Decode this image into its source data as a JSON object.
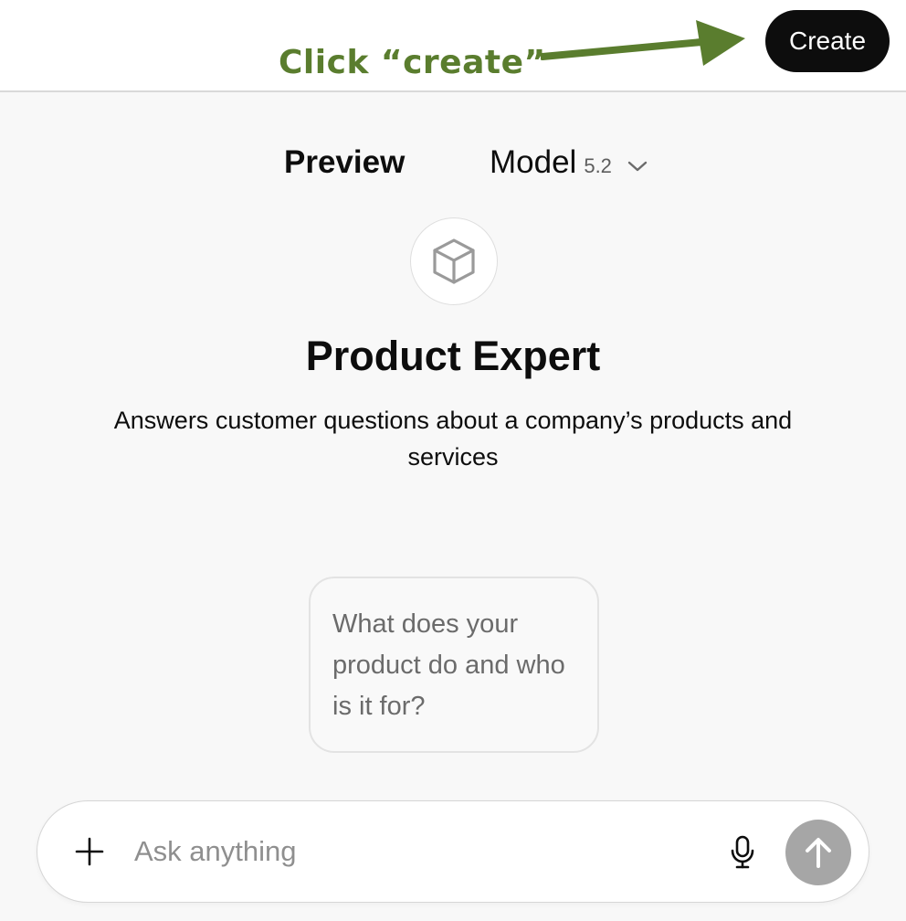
{
  "header": {
    "annotation_text": "Click “create”",
    "create_label": "Create"
  },
  "tabs": {
    "preview_label": "Preview",
    "model_label": "Model",
    "model_version": "5.2"
  },
  "gpt": {
    "name": "Product Expert",
    "description": "Answers customer questions about a company’s products and services",
    "avatar_icon": "cube-icon"
  },
  "starter": {
    "text": "What does your product do and who is it for?"
  },
  "composer": {
    "placeholder": "Ask anything",
    "value": ""
  },
  "icons": {
    "annotation_arrow": "arrow-right-icon",
    "chevron": "chevron-down-icon",
    "plus": "plus-icon",
    "mic": "microphone-icon",
    "send": "arrow-up-icon"
  },
  "colors": {
    "annotation": "#5a7d2e",
    "create_button": "#0d0d0d",
    "send_button_disabled": "#a6a6a6",
    "background": "#f8f8f8"
  }
}
